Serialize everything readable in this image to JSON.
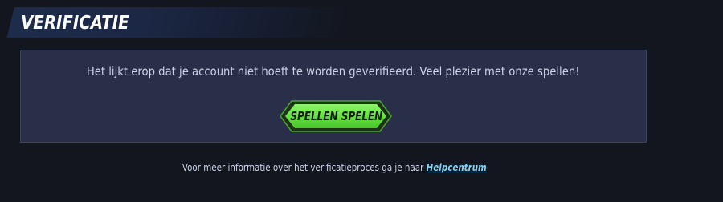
{
  "header": {
    "title": "VERIFICATIE"
  },
  "panel": {
    "message": "Het lijkt erop dat je account niet hoeft te worden geverifieerd. Veel plezier met onze spellen!",
    "cta_label": "SPELLEN SPELEN"
  },
  "footer": {
    "text": "Voor meer informatie over het verificatieproces ga je naar",
    "link_label": "Helpcentrum"
  },
  "colors": {
    "background": "#13161f",
    "panel": "#292f48",
    "accent_green": "#6ee84a",
    "link": "#7fd0f2"
  }
}
